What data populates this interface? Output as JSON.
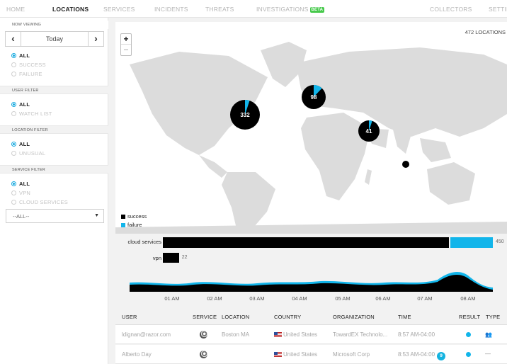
{
  "nav": {
    "home": "HOME",
    "locations": "LOCATIONS",
    "services": "SERVICES",
    "incidents": "INCIDENTS",
    "threats": "THREATS",
    "investigations": "INVESTIGATIONS",
    "beta": "BETA",
    "collectors": "COLLECTORS",
    "settings": "SETTIN"
  },
  "sidebar": {
    "now_viewing": "NOW VIEWING",
    "date_label": "Today",
    "prev_icon": "chevron-left-icon",
    "next_icon": "chevron-right-icon",
    "status_options": [
      "ALL",
      "SUCCESS",
      "FAILURE"
    ],
    "user_filter": {
      "title": "USER FILTER",
      "options": [
        "ALL",
        "WATCH LIST"
      ]
    },
    "location_filter": {
      "title": "LOCATION FILTER",
      "options": [
        "ALL",
        "UNUSUAL"
      ]
    },
    "service_filter": {
      "title": "SERVICE FILTER",
      "options": [
        "ALL",
        "VPN",
        "CLOUD SERVICES"
      ]
    },
    "service_select": "--ALL--",
    "select_caret": "caret-down-icon"
  },
  "map": {
    "zoom_in": "+",
    "zoom_out": "−",
    "location_count": "472 LOCATIONS",
    "clusters": [
      {
        "label": "332",
        "failure_share": 0.05
      },
      {
        "label": "98",
        "failure_share": 0.12
      },
      {
        "label": "41",
        "failure_share": 0.05
      },
      {
        "label": "",
        "failure_share": 0.0
      }
    ],
    "legend": [
      {
        "label": "success",
        "color": "#000000"
      },
      {
        "label": "failure",
        "color": "#12b5ea"
      }
    ]
  },
  "services": [
    {
      "label": "cloud services",
      "success": 390,
      "failure": 60,
      "total_label": "450"
    },
    {
      "label": "vpn",
      "success": 22,
      "failure": 0,
      "total_label": "22"
    }
  ],
  "timeline": {
    "labels": [
      "01 AM",
      "02 AM",
      "03 AM",
      "04 AM",
      "05 AM",
      "06 AM",
      "07 AM",
      "08 AM"
    ]
  },
  "table": {
    "headers": {
      "user": "USER",
      "service": "SERVICE",
      "location": "LOCATION",
      "country": "COUNTRY",
      "organization": "ORGANIZATION",
      "time": "TIME",
      "result": "RESULT",
      "type": "TYPE"
    },
    "rows": [
      {
        "user": "ldignan@razor.com",
        "service_icon": "vpn-service-icon",
        "location": "Boston MA",
        "country": "United States",
        "organization": "TowardEX Technolo...",
        "time": "8:57 AM-04:00",
        "badge": "",
        "result_color": "#12b5ea",
        "type_icon": "group-icon",
        "type_glyph": "👥"
      },
      {
        "user": "Alberto Day",
        "service_icon": "vpn-service-icon",
        "location": "",
        "country": "United States",
        "organization": "Microsoft Corp",
        "time": "8:53 AM-04:00",
        "badge": "9",
        "result_color": "#12b5ea",
        "type_icon": "dash-icon",
        "type_glyph": "—"
      }
    ]
  }
}
